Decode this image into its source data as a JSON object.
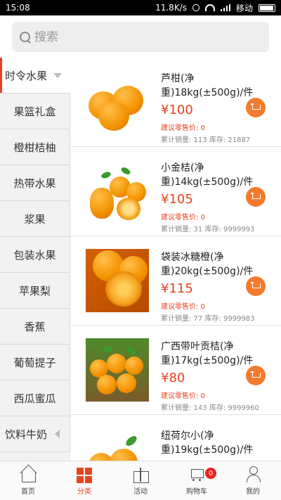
{
  "status_bar": {
    "time": "15:08",
    "network_speed": "11.8K/s",
    "carrier": "移动"
  },
  "search": {
    "placeholder": "搜索"
  },
  "sidebar": {
    "items": [
      {
        "label": "时令水果"
      },
      {
        "label": "果篮礼盒"
      },
      {
        "label": "橙柑桔柚"
      },
      {
        "label": "热带水果"
      },
      {
        "label": "浆果"
      },
      {
        "label": "包装水果"
      },
      {
        "label": "苹果梨"
      },
      {
        "label": "香蕉"
      },
      {
        "label": "葡萄提子"
      },
      {
        "label": "西瓜蜜瓜"
      },
      {
        "label": "饮料牛奶"
      }
    ]
  },
  "products": [
    {
      "name": "芦柑(净重)18kg(±500g)/件",
      "price": "¥100",
      "suggest": "建议零售价: 0",
      "stats": "累计销量: 113   库存: 21887"
    },
    {
      "name": "小金桔(净重)14kg(±500g)/件",
      "price": "¥105",
      "suggest": "建议零售价: 0",
      "stats": "累计销量: 31   库存: 9999993"
    },
    {
      "name": "袋装冰糖橙(净重)20kg(±500g)/件",
      "price": "¥115",
      "suggest": "建议零售价: 0",
      "stats": "累计销量: 77   库存: 9999983"
    },
    {
      "name": "广西带叶贡桔(净重)17kg(±500g)/件",
      "price": "¥80",
      "suggest": "建议零售价: 0",
      "stats": "累计销量: 143   库存: 9999960"
    },
    {
      "name": "纽荷尔小(净重)19kg(±500g)/件",
      "price": "",
      "suggest": "",
      "stats": ""
    }
  ],
  "tabbar": {
    "home": "首页",
    "category": "分类",
    "activity": "活动",
    "cart": "购物车",
    "cart_count": "0",
    "mine": "我的"
  },
  "colors": {
    "accent": "#e8431f",
    "cart_button": "#f47a2e"
  }
}
